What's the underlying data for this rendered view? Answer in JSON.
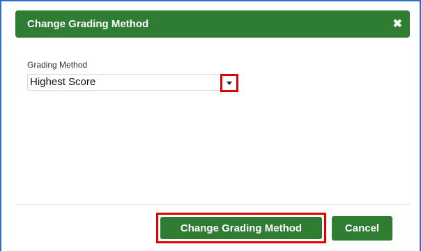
{
  "dialog": {
    "title": "Change Grading Method",
    "close_glyph": "✖",
    "close_icon": "close-icon"
  },
  "form": {
    "field_label": "Grading Method",
    "selected_value": "Highest Score",
    "dropdown_icon": "chevron-down-icon"
  },
  "footer": {
    "confirm_label": "Change Grading Method",
    "cancel_label": "Cancel"
  },
  "colors": {
    "header_green": "#2e7d32",
    "highlight_red": "#e00000",
    "frame_blue": "#2b6fc7"
  }
}
